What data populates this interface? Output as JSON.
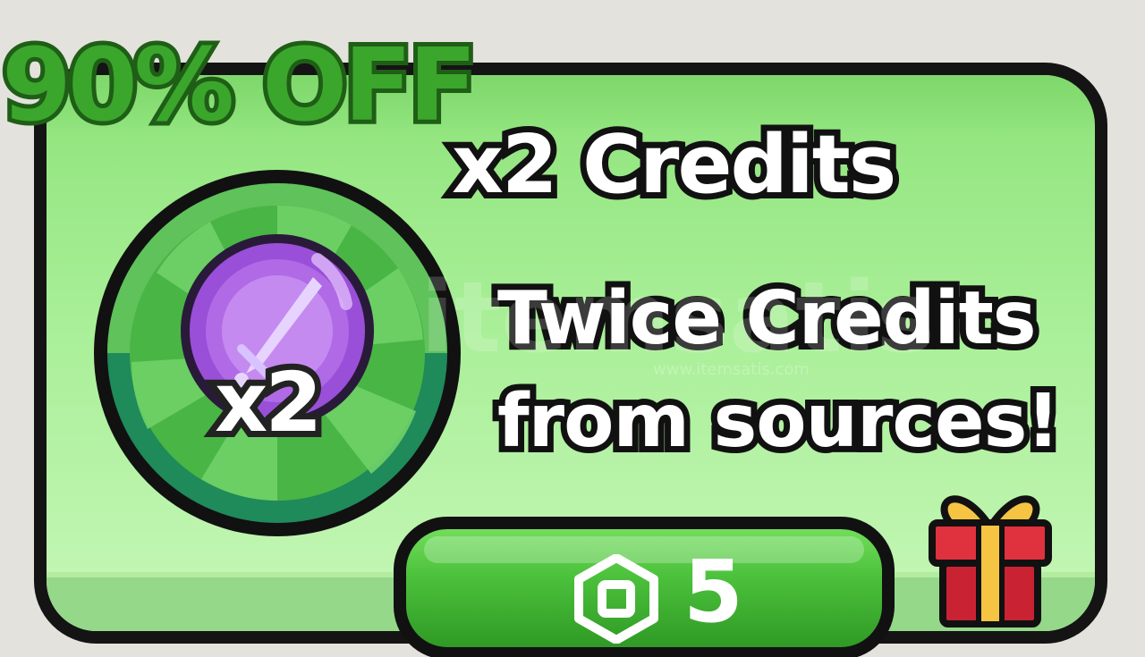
{
  "offer": {
    "discount_label": "90% OFF",
    "title": "x2 Credits",
    "description": "Twice Credits from sources!",
    "multiplier": "x2",
    "price": "5",
    "currency_icon": "robux-icon",
    "gift_icon": "gift-icon"
  },
  "watermark": {
    "text": "itemsatis",
    "subtext": "www.itemsatis.com"
  },
  "colors": {
    "card": "#a9ef98",
    "discount": "#3ba62c",
    "button": "#4cc13c",
    "badge_ring": "#1f8a5a",
    "orb": "#b06ae6",
    "gift_box": "#e0313f",
    "gift_ribbon": "#f6c443"
  }
}
